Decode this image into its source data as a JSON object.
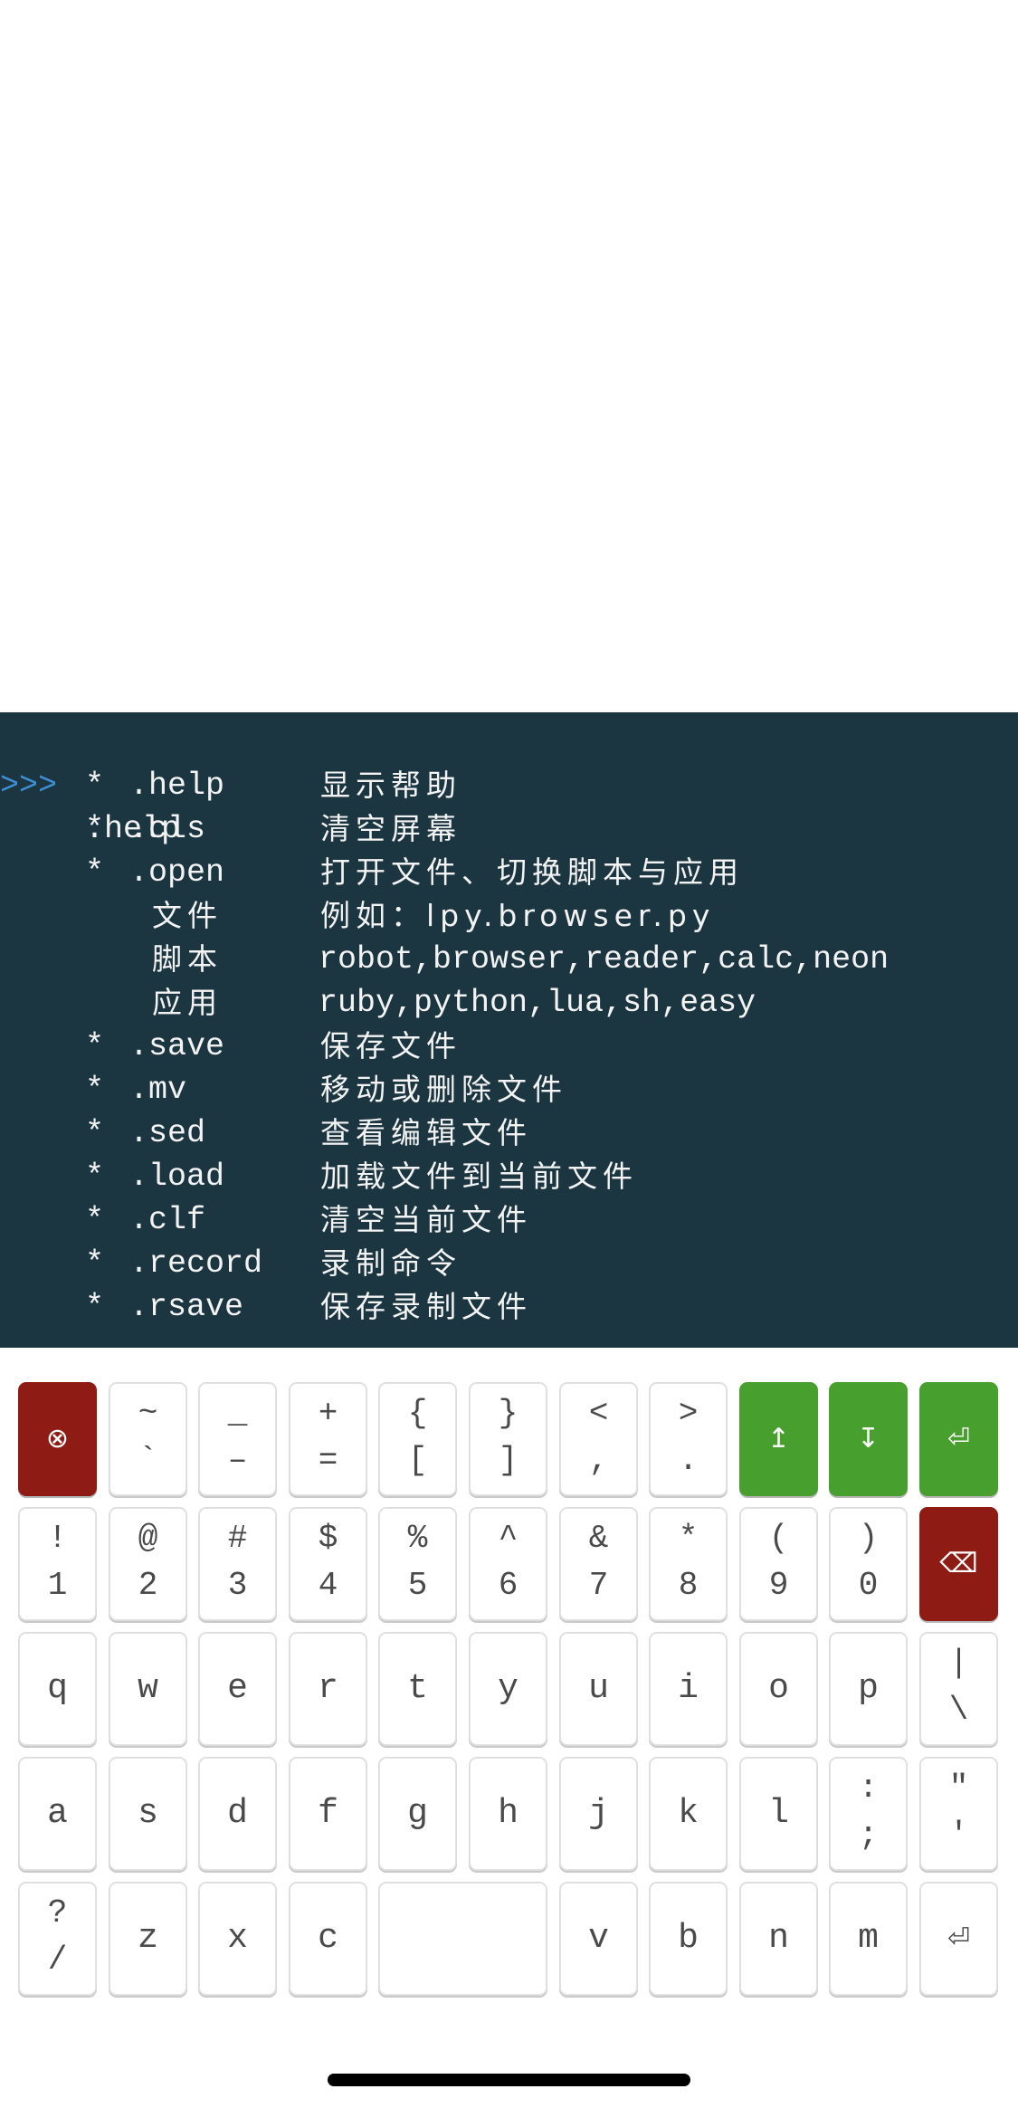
{
  "terminal": {
    "prompt": ">>>",
    "command": ".help",
    "lines": [
      {
        "bullet": "*",
        "cmd": ".help",
        "desc": "显示帮助"
      },
      {
        "bullet": "*",
        "cmd": ".cls",
        "desc": "清空屏幕"
      },
      {
        "bullet": "*",
        "cmd": ".open",
        "desc": "打开文件、切换脚本与应用"
      },
      {
        "sub": "文件",
        "desc": "例如：lpy.browser.py"
      },
      {
        "sub": "脚本",
        "desc": "robot,browser,reader,calc,neon"
      },
      {
        "sub": "应用",
        "desc": "ruby,python,lua,sh,easy"
      },
      {
        "bullet": "*",
        "cmd": ".save",
        "desc": "保存文件"
      },
      {
        "bullet": "*",
        "cmd": ".mv",
        "desc": "移动或删除文件"
      },
      {
        "bullet": "*",
        "cmd": ".sed",
        "desc": "查看编辑文件"
      },
      {
        "bullet": "*",
        "cmd": ".load",
        "desc": "加载文件到当前文件"
      },
      {
        "bullet": "*",
        "cmd": ".clf",
        "desc": "清空当前文件"
      },
      {
        "bullet": "*",
        "cmd": ".record",
        "desc": "录制命令"
      },
      {
        "bullet": "*",
        "cmd": ".rsave",
        "desc": "保存录制文件"
      }
    ]
  },
  "keyboard": {
    "row1": [
      {
        "type": "icon",
        "icon": "⊗",
        "icon_name": "cancel-icon",
        "color": "red"
      },
      {
        "top": "~",
        "bottom": "`"
      },
      {
        "top": "_",
        "bottom": "–"
      },
      {
        "top": "+",
        "bottom": "="
      },
      {
        "top": "{",
        "bottom": "["
      },
      {
        "top": "}",
        "bottom": "]"
      },
      {
        "top": "<",
        "bottom": ","
      },
      {
        "top": ">",
        "bottom": "."
      },
      {
        "type": "icon",
        "icon": "↥",
        "icon_name": "arrow-up-icon",
        "color": "green"
      },
      {
        "type": "icon",
        "icon": "↧",
        "icon_name": "arrow-down-icon",
        "color": "green"
      },
      {
        "type": "icon",
        "icon": "⏎",
        "icon_name": "return-icon",
        "color": "green"
      }
    ],
    "row2": [
      {
        "top": "!",
        "bottom": "1"
      },
      {
        "top": "@",
        "bottom": "2"
      },
      {
        "top": "#",
        "bottom": "3"
      },
      {
        "top": "$",
        "bottom": "4"
      },
      {
        "top": "%",
        "bottom": "5"
      },
      {
        "top": "^",
        "bottom": "6"
      },
      {
        "top": "&",
        "bottom": "7"
      },
      {
        "top": "*",
        "bottom": "8"
      },
      {
        "top": "(",
        "bottom": "9"
      },
      {
        "top": ")",
        "bottom": "0"
      },
      {
        "type": "icon",
        "icon": "⌫",
        "icon_name": "backspace-icon",
        "color": "red"
      }
    ],
    "row3": [
      {
        "single": "q"
      },
      {
        "single": "w"
      },
      {
        "single": "e"
      },
      {
        "single": "r"
      },
      {
        "single": "t"
      },
      {
        "single": "y"
      },
      {
        "single": "u"
      },
      {
        "single": "i"
      },
      {
        "single": "o"
      },
      {
        "single": "p"
      },
      {
        "top": "|",
        "bottom": "\\"
      }
    ],
    "row4": [
      {
        "single": "a"
      },
      {
        "single": "s"
      },
      {
        "single": "d"
      },
      {
        "single": "f"
      },
      {
        "single": "g"
      },
      {
        "single": "h"
      },
      {
        "single": "j"
      },
      {
        "single": "k"
      },
      {
        "single": "l"
      },
      {
        "top": ":",
        "bottom": ";"
      },
      {
        "top": "\"",
        "bottom": "'"
      }
    ],
    "row5": [
      {
        "top": "?",
        "bottom": "/"
      },
      {
        "single": "z"
      },
      {
        "single": "x"
      },
      {
        "single": "c"
      },
      {
        "type": "space",
        "single": ""
      },
      {
        "single": "v"
      },
      {
        "single": "b"
      },
      {
        "single": "n"
      },
      {
        "single": "m"
      },
      {
        "type": "icon",
        "icon": "⏎",
        "icon_name": "enter-icon",
        "color": "white"
      }
    ]
  },
  "colors": {
    "terminal_bg": "#1b3641",
    "prompt": "#3e8fd6",
    "key_red": "#8e1b14",
    "key_green": "#47a02d"
  }
}
